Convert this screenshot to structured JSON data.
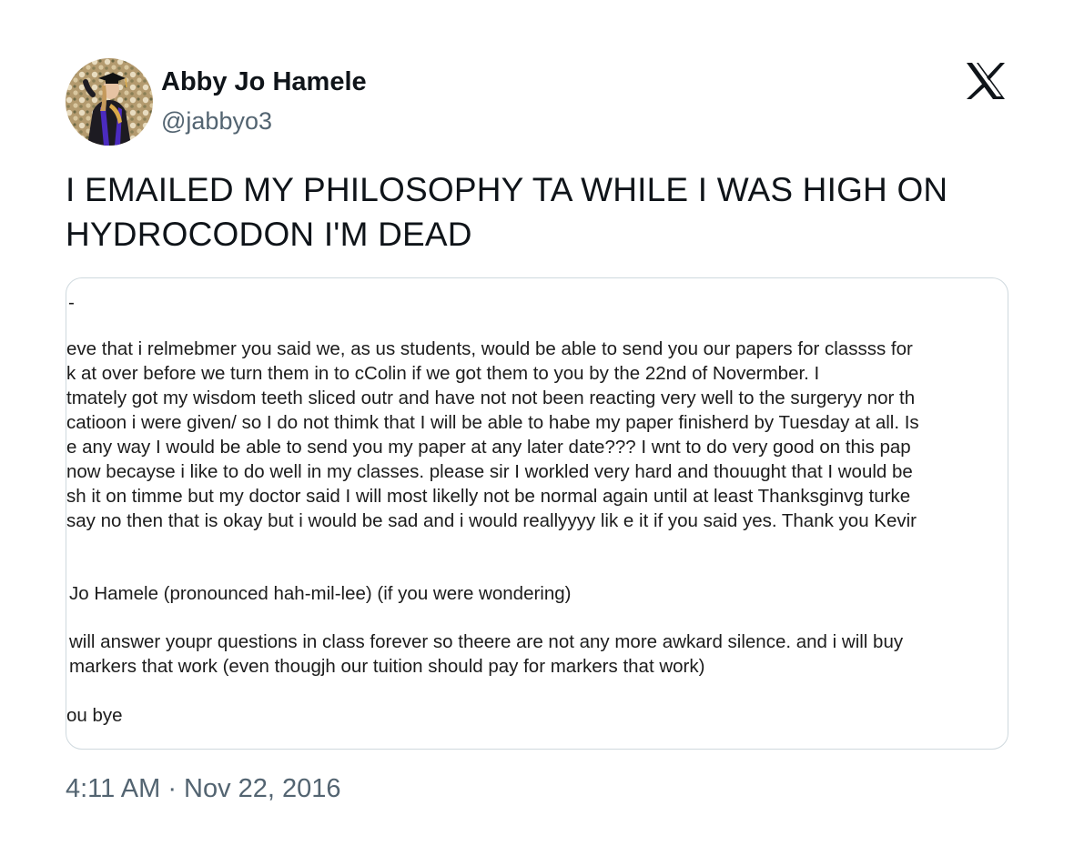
{
  "author": {
    "display_name": "Abby Jo Hamele",
    "handle": "@jabbyo3"
  },
  "tweet": {
    "text": "I EMAILED MY PHILOSOPHY TA WHILE I WAS HIGH ON HYDROCODON I'M DEAD",
    "time": "4:11 AM",
    "separator": "·",
    "date": "Nov 22, 2016"
  },
  "brand": {
    "logo_icon": "x-logo-icon",
    "text_color": "#0f1419",
    "secondary_color": "#536471",
    "border_color": "#cfd9de"
  },
  "media": {
    "lines": [
      "-",
      "eve that i relmebmer you said we, as us students, would be able to send you our papers for classss for",
      "k at over before we turn them in to cColin if we got them to you by the 22nd of Novermber. I",
      "tmately got my wisdom teeth sliced outr and have not not been reacting very well to the surgeryy nor th",
      "catioon i were given/ so I do not thimk that I will be able to habe my paper finisherd by Tuesday at all. Is",
      "e any way I would be able to send you my paper at any later date??? I wnt to do very good on this pap",
      "now becayse i like to do well in my classes. please sir I workled very hard and thouught that I would be",
      "sh it on timme but my doctor said I will most likelly not be normal again until at least Thanksginvg turke",
      "say no then that is okay but i would be sad and i would reallyyyy lik e it if you said yes. Thank you Kevir",
      "Jo Hamele (pronounced hah-mil-lee) (if you were wondering)",
      "will answer youpr questions in class forever so theere are not any more awkard silence. and  i will buy",
      "markers that work (even thougjh our tuition should pay for markers that work)",
      "ou bye"
    ]
  }
}
